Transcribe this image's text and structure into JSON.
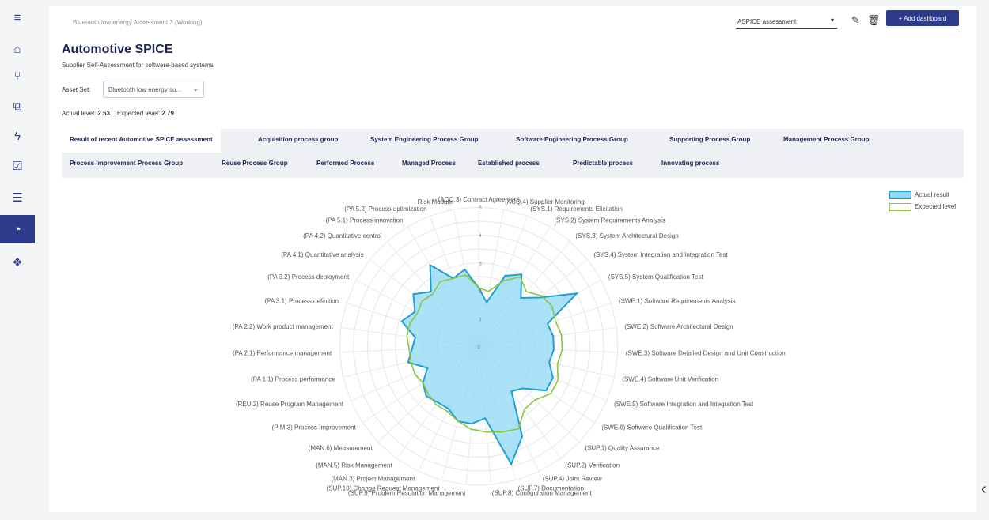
{
  "sidebar": {
    "items": [
      {
        "icon": "menu-icon",
        "glyph": "≡",
        "active": false
      },
      {
        "icon": "assets-icon",
        "glyph": "⌂",
        "active": false
      },
      {
        "icon": "hierarchy-icon",
        "glyph": "⑂",
        "active": false
      },
      {
        "icon": "copy-icon",
        "glyph": "⧉",
        "active": false
      },
      {
        "icon": "lightning-icon",
        "glyph": "ϟ",
        "active": false
      },
      {
        "icon": "clipboard-check-icon",
        "glyph": "☑",
        "active": false
      },
      {
        "icon": "document-icon",
        "glyph": "☰",
        "active": false
      },
      {
        "icon": "dashboard-icon",
        "glyph": "◔",
        "active": true
      },
      {
        "icon": "network-icon",
        "glyph": "❖",
        "active": false
      }
    ]
  },
  "header": {
    "breadcrumb": "Bluetooth low energy Assessment 3 (Working)",
    "dashboard_select": "ASPICE assessment",
    "add_dashboard": "+ Add dashboard"
  },
  "page": {
    "title": "Automotive SPICE",
    "subtitle": "Supplier Self-Assessment for software-based systems",
    "asset_set_label": "Asset Set:",
    "asset_set_value": "Bluetooth low energy su...",
    "actual_label": "Actual level:",
    "actual_value": "2.53",
    "expected_label": "Expected level:",
    "expected_value": "2.79"
  },
  "tabs_row1": [
    "Result of recent Automotive SPICE assessment",
    "Acquisition process group",
    "System Engineering Process Group",
    "Software Engineering Process Group",
    "Supporting Process Group",
    "Management Process Group"
  ],
  "tabs_row2": [
    "Process Improvement Process Group",
    "Reuse Process Group",
    "Performed Process",
    "Managed Process",
    "Established process",
    "Predictable process",
    "Innovating process"
  ],
  "colors": {
    "primary": "#2e3a8c",
    "actual_fill": "#8fd8f5",
    "actual_stroke": "#1f9fd6",
    "expected_stroke": "#8cc63f"
  },
  "chart_data": {
    "type": "radar",
    "rmax": 5,
    "ticks": [
      "1",
      "2",
      "3",
      "4",
      "5"
    ],
    "legend": [
      "Actual result",
      "Expected level"
    ],
    "legend_position": "top-right",
    "categories": [
      "(ACQ.3) Contract Agreement",
      "(ACQ.4) Supplier Monitoring",
      "(SYS.1) Requirements Elicitation",
      "(SYS.2) System Requirements Analysis",
      "(SYS.3) System Architectural Design",
      "(SYS.4) System Integration and Integration Test",
      "(SYS.5) System Qualification Test",
      "(SWE.1) Software Requirements Analysis",
      "(SWE.2) Software Architectural Design",
      "(SWE.3) Software Detailed Design and Unit Construction",
      "(SWE.4) Software Unit Verification",
      "(SWE.5) Software Integration and Integration Test",
      "(SWE.6) Software Qualification Test",
      "(SUP.1) Quality Assurance",
      "(SUP.2) Verification",
      "(SUP.4) Joint Review",
      "(SUP.7) Documentation",
      "(SUP.8) Configuration Management",
      "(SUP.9) Problem Resolution Management",
      "(SUP.10) Change Request Management",
      "(MAN.3) Project Management",
      "(MAN.5) Risk Management",
      "(MAN.6) Measurement",
      "(PIM.3) Process Improvement",
      "(REU.2) Reuse Program Management",
      "(PA 1.1) Process performance",
      "(PA 2.1) Performance management",
      "(PA 2.2) Work product management",
      "(PA 3.1) Process definition",
      "(PA 3.2) Process deployment",
      "(PA 4.1) Quantitative analysis",
      "(PA 4.2) Quantitative control",
      "(PA 5.1) Process innovation",
      "(PA 5.2) Process optimization",
      "Risk Module"
    ],
    "series": [
      {
        "name": "Actual result",
        "values": [
          2.1,
          1.6,
          2.7,
          3.0,
          2.3,
          2.8,
          4.0,
          2.6,
          2.7,
          2.7,
          2.6,
          2.9,
          2.9,
          2.2,
          2.0,
          3.6,
          4.4,
          2.6,
          2.8,
          2.8,
          2.5,
          2.5,
          2.6,
          2.4,
          2.0,
          2.6,
          2.4,
          2.3,
          2.9,
          2.6,
          3.0,
          2.6,
          3.4,
          2.6,
          2.8
        ]
      },
      {
        "name": "Expected level",
        "values": [
          2.1,
          2.0,
          2.5,
          2.9,
          2.6,
          2.9,
          3.0,
          2.9,
          3.0,
          3.0,
          2.9,
          3.1,
          3.1,
          2.8,
          2.8,
          3.3,
          3.2,
          3.1,
          3.0,
          2.8,
          2.6,
          2.6,
          2.5,
          2.4,
          2.5,
          2.5,
          2.5,
          2.6,
          2.6,
          2.5,
          2.6,
          2.5,
          2.7,
          2.6,
          2.6
        ]
      }
    ]
  }
}
